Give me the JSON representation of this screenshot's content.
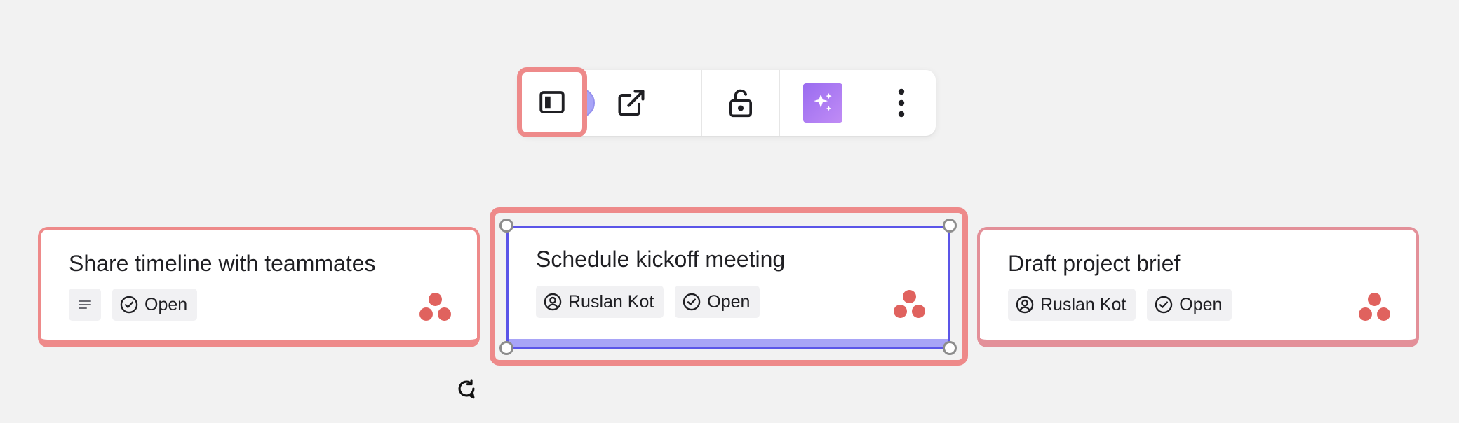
{
  "toolbar": {
    "items": [
      {
        "name": "panel-toggle",
        "icon": "sidebar-panel-icon"
      },
      {
        "name": "color",
        "icon": "color-dot",
        "color": "#a8a4f7"
      },
      {
        "name": "open-external",
        "icon": "external-link-icon"
      },
      {
        "name": "lock",
        "icon": "unlock-icon"
      },
      {
        "name": "ai-assist",
        "icon": "sparkles-icon"
      },
      {
        "name": "more",
        "icon": "more-vertical-icon"
      }
    ]
  },
  "cards": [
    {
      "title": "Share timeline with teammates",
      "chips": [
        {
          "type": "description",
          "icon": "description-lines-icon",
          "label": ""
        },
        {
          "type": "status",
          "icon": "check-circle-icon",
          "label": "Open"
        }
      ],
      "app_icon": "asana-logo-icon"
    },
    {
      "title": "Schedule kickoff meeting",
      "chips": [
        {
          "type": "assignee",
          "icon": "user-circle-icon",
          "label": "Ruslan Kot"
        },
        {
          "type": "status",
          "icon": "check-circle-icon",
          "label": "Open"
        }
      ],
      "app_icon": "asana-logo-icon",
      "selected": true
    },
    {
      "title": "Draft project brief",
      "chips": [
        {
          "type": "assignee",
          "icon": "user-circle-icon",
          "label": "Ruslan Kot"
        },
        {
          "type": "status",
          "icon": "check-circle-icon",
          "label": "Open"
        }
      ],
      "app_icon": "asana-logo-icon"
    }
  ],
  "colors": {
    "canvas": "#f2f2f2",
    "card_border": "#ee8a8a",
    "selection": "#5b55e8",
    "selection_fill": "#a8a4f7",
    "asana": "#e0625e",
    "ai_gradient_start": "#9a6cf0",
    "ai_gradient_end": "#c08cf5"
  }
}
